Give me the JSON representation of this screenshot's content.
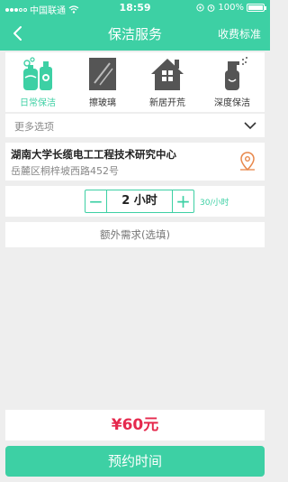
{
  "status_bar": {
    "carrier": "中国联通",
    "time": "18:59",
    "battery": "100%"
  },
  "nav": {
    "title": "保洁服务",
    "fee_link": "收费标准"
  },
  "categories": [
    {
      "label": "日常保洁",
      "icon": "cleaning-bottles-icon",
      "active": true
    },
    {
      "label": "擦玻璃",
      "icon": "window-glass-icon",
      "active": false
    },
    {
      "label": "新居开荒",
      "icon": "house-icon",
      "active": false
    },
    {
      "label": "深度保洁",
      "icon": "spray-bottle-icon",
      "active": false
    }
  ],
  "more_options": {
    "label": "更多选项"
  },
  "address": {
    "title": "湖南大学长缆电工工程技术研究中心",
    "detail": "岳麓区桐梓坡西路452号"
  },
  "duration": {
    "minus": "−",
    "value": "2 小时",
    "plus": "+",
    "rate": "30/小时"
  },
  "extra": {
    "label": "额外需求(选填)"
  },
  "price": {
    "label": "¥60元"
  },
  "book_button": {
    "label": "预约时间"
  },
  "colors": {
    "accent": "#3dd0a4",
    "price": "#e5294d",
    "background": "#eeeeee"
  }
}
